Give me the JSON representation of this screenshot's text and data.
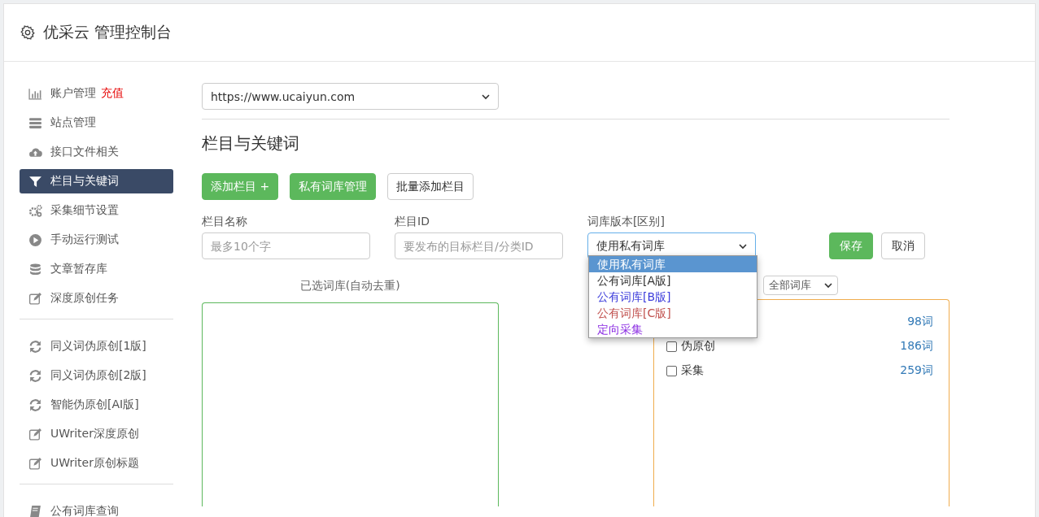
{
  "header": {
    "title": "优采云 管理控制台"
  },
  "sidebar": {
    "groups": [
      [
        {
          "label": "账户管理",
          "badge": "充值",
          "selected": false
        },
        {
          "label": "站点管理",
          "selected": false
        },
        {
          "label": "接口文件相关",
          "selected": false
        },
        {
          "label": "栏目与关键词",
          "selected": true
        },
        {
          "label": "采集细节设置",
          "selected": false
        },
        {
          "label": "手动运行测试",
          "selected": false
        },
        {
          "label": "文章暂存库",
          "selected": false
        },
        {
          "label": "深度原创任务",
          "selected": false
        }
      ],
      [
        {
          "label": "同义词伪原创[1版]",
          "selected": false
        },
        {
          "label": "同义词伪原创[2版]",
          "selected": false
        },
        {
          "label": "智能伪原创[AI版]",
          "selected": false
        },
        {
          "label": "UWriter深度原创",
          "selected": false
        },
        {
          "label": "UWriter原创标题",
          "selected": false
        }
      ],
      [
        {
          "label": "公有词库查询",
          "selected": false
        }
      ]
    ]
  },
  "main": {
    "site_select": "https://www.ucaiyun.com",
    "heading": "栏目与关键词",
    "buttons": [
      {
        "label": "添加栏目 +",
        "kind": "primary"
      },
      {
        "label": "私有词库管理",
        "kind": "primary"
      },
      {
        "label": "批量添加栏目",
        "kind": "default"
      }
    ],
    "form": {
      "name_label": "栏目名称",
      "name_placeholder": "最多10个字",
      "id_label": "栏目ID",
      "id_placeholder": "要发布的目标栏目/分类ID",
      "version_label": "词库版本[区别]",
      "version_value": "使用私有词库",
      "save": "保存",
      "cancel": "取消",
      "version_options": [
        {
          "label": "使用私有词库",
          "selected": true
        },
        {
          "label": "公有词库[A版]",
          "selected": false,
          "color": "#333333"
        },
        {
          "label": "公有词库[B版]",
          "selected": false,
          "color": "#3b3bdb"
        },
        {
          "label": "公有词库[C版]",
          "selected": false,
          "color": "#c0504d"
        },
        {
          "label": "定向采集",
          "selected": false,
          "color": "#8a2be2"
        }
      ]
    },
    "selected_title": "已选词库(自动去重)",
    "filter_select": "全部词库",
    "libraries": [
      {
        "count": "98词"
      },
      {
        "label": "伪原创",
        "checked": false,
        "count": "186词"
      },
      {
        "label": "采集",
        "checked": false,
        "count": "259词"
      }
    ]
  }
}
